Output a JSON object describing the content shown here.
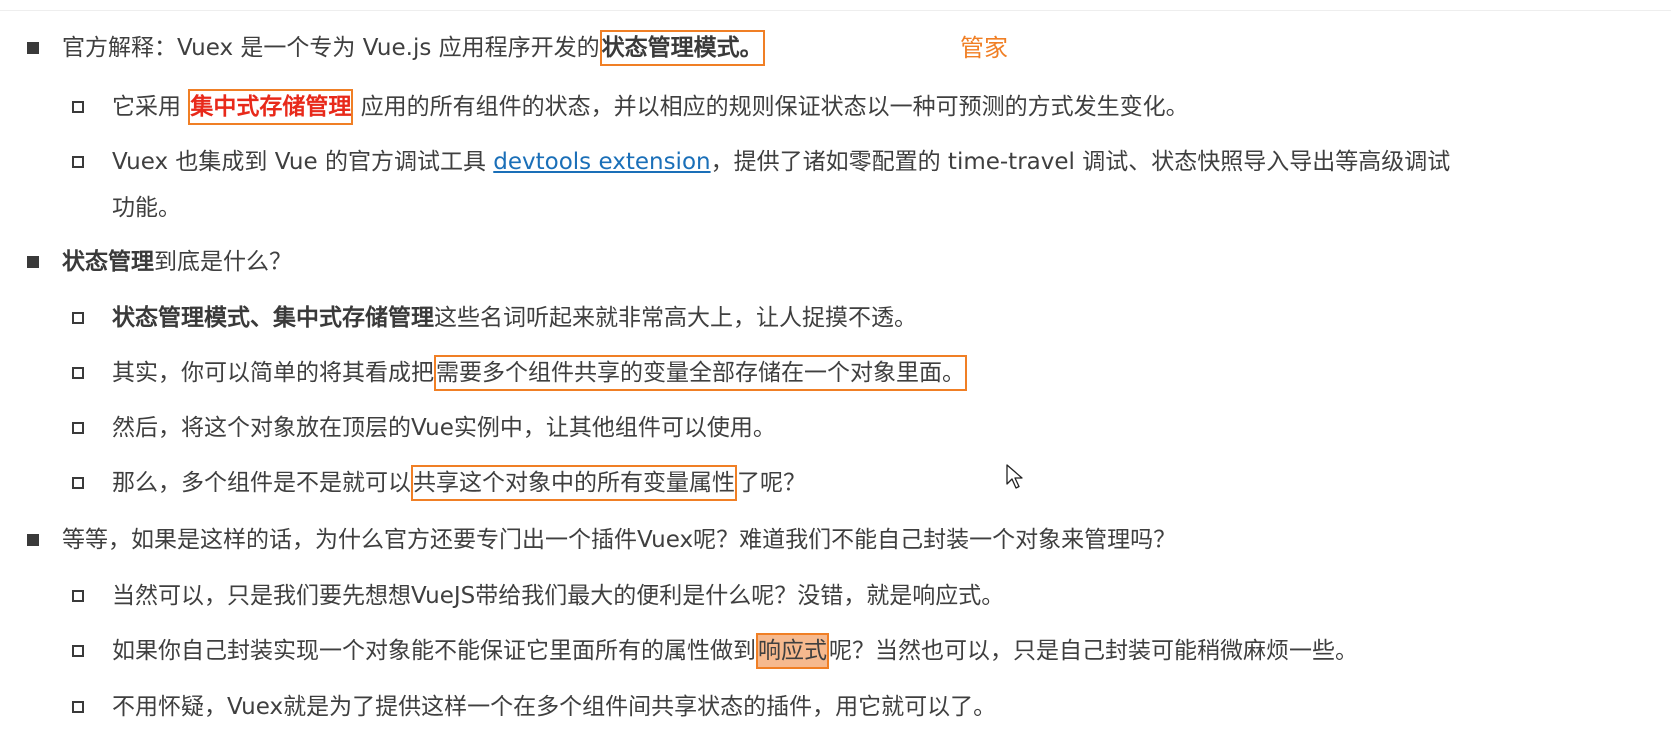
{
  "note": "管家",
  "sections": [
    {
      "line1_pre": "官方解释：Vuex 是一个专为 Vue.js 应用程序开发的",
      "line1_box": "状态管理模式。",
      "items": [
        {
          "pre": "它采用",
          "box": "集中式存储管理",
          "post": "应用的所有组件的状态，并以相应的规则保证状态以一种可预测的方式发生变化。"
        },
        {
          "pre": "Vuex 也集成到 Vue 的官方调试工具 ",
          "link": "devtools extension",
          "post": "，提供了诸如零配置的 time-travel 调试、状态快照导入导出等高级调试",
          "wrap": "功能。"
        }
      ]
    },
    {
      "bold": "状态管理",
      "rest": "到底是什么？",
      "items": [
        {
          "bold": "状态管理模式、集中式存储管理",
          "post": "这些名词听起来就非常高大上，让人捉摸不透。"
        },
        {
          "pre": "其实，你可以简单的将其看成把",
          "box": "需要多个组件共享的变量全部存储在一个对象里面。"
        },
        {
          "pre": "然后，将这个对象放在顶层的Vue实例中，让其他组件可以使用。"
        },
        {
          "pre": "那么，多个组件是不是就可以",
          "box": "共享这个对象中的所有变量属性",
          "post": "了呢？"
        }
      ]
    },
    {
      "text": "等等，如果是这样的话，为什么官方还要专门出一个插件Vuex呢？难道我们不能自己封装一个对象来管理吗？",
      "items": [
        {
          "pre": "当然可以，只是我们要先想想VueJS带给我们最大的便利是什么呢？没错，就是响应式。"
        },
        {
          "pre": "如果你自己封装实现一个对象能不能保证它里面所有的属性做到",
          "hl": "响应式",
          "post": "呢？当然也可以，只是自己封装可能稍微麻烦一些。"
        },
        {
          "pre": "不用怀疑，Vuex就是为了提供这样一个在多个组件间共享状态的插件，用它就可以了。"
        }
      ]
    }
  ]
}
